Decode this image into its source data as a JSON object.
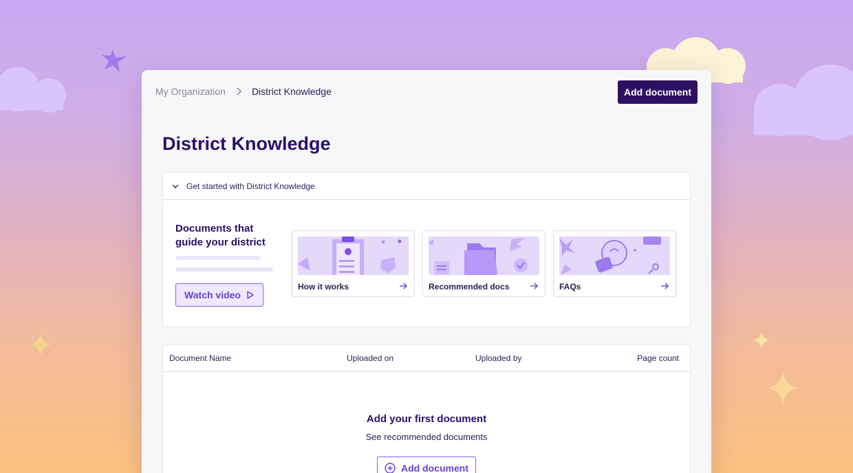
{
  "breadcrumb": {
    "root": "My Organization",
    "current": "District Knowledge"
  },
  "header": {
    "add_document_label": "Add document"
  },
  "page": {
    "title": "District Knowledge"
  },
  "get_started": {
    "heading": "Get started with District Knowledge",
    "intro_title": "Documents that guide your district",
    "watch_video_label": "Watch video",
    "tiles": [
      {
        "label": "How it works",
        "icon": "clipboard-icon"
      },
      {
        "label": "Recommended docs",
        "icon": "folder-icon"
      },
      {
        "label": "FAQs",
        "icon": "lightbulb-icon"
      }
    ]
  },
  "table": {
    "columns": [
      "Document Name",
      "Uploaded on",
      "Uploaded by",
      "Page count"
    ],
    "empty_title": "Add your first document",
    "empty_subtitle": "See recommended documents",
    "add_document_label": "Add document"
  },
  "colors": {
    "primary": "#2e1063",
    "accent": "#6a3fd4",
    "title": "#2a0f66"
  }
}
